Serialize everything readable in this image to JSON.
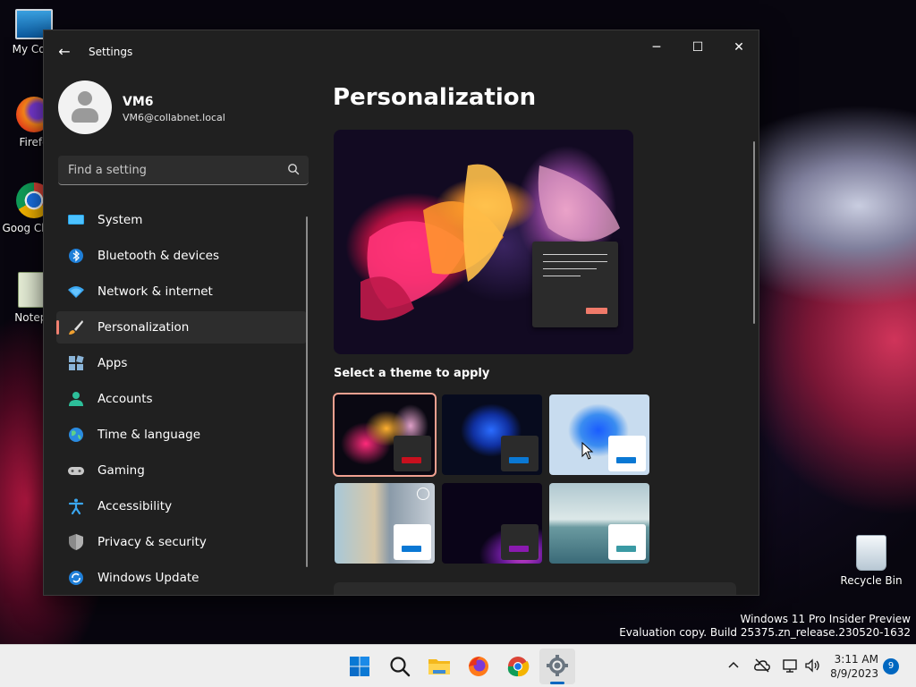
{
  "desktop": {
    "icons": [
      {
        "label": "My Com"
      },
      {
        "label": "Firefo"
      },
      {
        "label": "Goog Chron"
      },
      {
        "label": "Notepa"
      },
      {
        "label": "Recycle Bin"
      }
    ],
    "watermark": {
      "line1": "Windows 11 Pro Insider Preview",
      "line2": "Evaluation copy. Build 25375.zn_release.230520-1632"
    }
  },
  "window": {
    "title": "Settings",
    "controls": {
      "minimize": "─",
      "maximize": "☐",
      "close": "✕"
    },
    "back_icon": "←"
  },
  "profile": {
    "name": "VM6",
    "email": "VM6@collabnet.local"
  },
  "search": {
    "placeholder": "Find a setting"
  },
  "nav": {
    "items": [
      {
        "label": "System",
        "icon": "system-icon"
      },
      {
        "label": "Bluetooth & devices",
        "icon": "bluetooth-icon"
      },
      {
        "label": "Network & internet",
        "icon": "wifi-icon"
      },
      {
        "label": "Personalization",
        "icon": "brush-icon",
        "selected": true
      },
      {
        "label": "Apps",
        "icon": "apps-icon"
      },
      {
        "label": "Accounts",
        "icon": "accounts-icon"
      },
      {
        "label": "Time & language",
        "icon": "globe-icon"
      },
      {
        "label": "Gaming",
        "icon": "gamepad-icon"
      },
      {
        "label": "Accessibility",
        "icon": "accessibility-icon"
      },
      {
        "label": "Privacy & security",
        "icon": "shield-icon"
      },
      {
        "label": "Windows Update",
        "icon": "update-icon"
      }
    ]
  },
  "content": {
    "title": "Personalization",
    "theme_heading": "Select a theme to apply",
    "themes": [
      {
        "name": "glow-dark",
        "accent": "#c8101e",
        "selected": true
      },
      {
        "name": "bloom-dark",
        "accent": "#0a78d4"
      },
      {
        "name": "bloom-light",
        "accent": "#0a78d4"
      },
      {
        "name": "captured-motion",
        "accent": "#0a78d4"
      },
      {
        "name": "flow",
        "accent": "#8a1ab0"
      },
      {
        "name": "sunrise",
        "accent": "#3a9aa4"
      }
    ]
  },
  "taskbar": {
    "apps": [
      "start-icon",
      "search-icon",
      "file-explorer-icon",
      "firefox-icon",
      "chrome-icon",
      "settings-icon"
    ],
    "time": "3:11 AM",
    "date": "8/9/2023",
    "notification_count": "9"
  },
  "colors": {
    "accent": "#f08070",
    "window_bg": "#202020",
    "selected_nav_bg": "#2d2d2d",
    "taskbar_bg": "#eeeeee"
  }
}
